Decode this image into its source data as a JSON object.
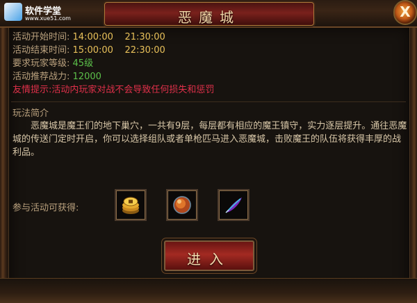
{
  "window": {
    "title": "恶魔城",
    "close_label": "X"
  },
  "watermark": {
    "name": "软件学堂",
    "url": "www.xue51.com"
  },
  "info": {
    "start_label": "活动开始时间:",
    "start_value": "14:00:00    21:30:00",
    "end_label": "活动结束时间:",
    "end_value": "15:00:00    22:30:00",
    "level_label": "要求玩家等级:",
    "level_value": "45级",
    "power_label": "活动推荐战力:",
    "power_value": "12000",
    "tip": "友情提示:活动内玩家对战不会导致任何损失和惩罚"
  },
  "gameplay": {
    "title": "玩法简介",
    "description": "恶魔城是魔王们的地下巢穴，一共有9层，每层都有相应的魔王镇守，实力逐层提升。通往恶魔城的传送门定时开启，你可以选择组队或者单枪匹马进入恶魔城，击败魔王的队伍将获得丰厚的战利品。"
  },
  "rewards": {
    "label": "参与活动可获得:",
    "items": [
      {
        "icon": "gold-coins-icon"
      },
      {
        "icon": "fire-orb-icon"
      },
      {
        "icon": "feather-icon"
      }
    ]
  },
  "enter_button": {
    "label": "进入"
  },
  "colors": {
    "accent": "#e8c05a",
    "green": "#5cc04a",
    "tip": "#e0304a",
    "label": "#b9a07d"
  }
}
